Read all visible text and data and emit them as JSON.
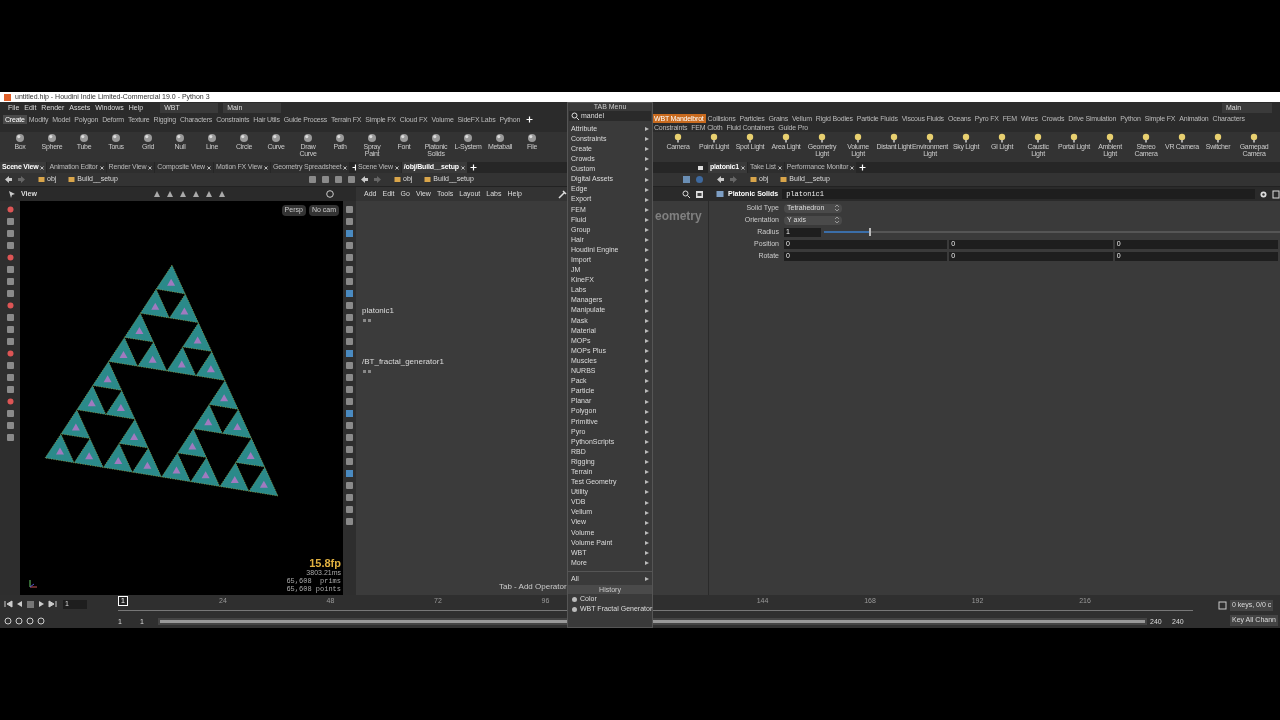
{
  "title_bar": {
    "title": "untitled.hip - Houdini Indie Limited-Commercial 19.0 - Python 3"
  },
  "menu_bar": {
    "items": [
      "File",
      "Edit",
      "Render",
      "Assets",
      "Windows",
      "Help"
    ],
    "desktop": "WBT",
    "workspace": "Main",
    "right_workspace": "Main"
  },
  "shelf_left": {
    "tabs": [
      {
        "label": "Create",
        "selected": true
      },
      {
        "label": "Modify",
        "selected": false
      },
      {
        "label": "Model",
        "selected": false
      },
      {
        "label": "Polygon",
        "selected": false
      },
      {
        "label": "Deform",
        "selected": false
      },
      {
        "label": "Texture",
        "selected": false
      },
      {
        "label": "Rigging",
        "selected": false
      },
      {
        "label": "Characters",
        "selected": false
      },
      {
        "label": "Constraints",
        "selected": false
      },
      {
        "label": "Hair Utils",
        "selected": false
      },
      {
        "label": "Guide Process",
        "selected": false
      },
      {
        "label": "Terrain FX",
        "selected": false
      },
      {
        "label": "Simple FX",
        "selected": false
      },
      {
        "label": "Cloud FX",
        "selected": false
      },
      {
        "label": "Volume",
        "selected": false
      },
      {
        "label": "SideFX Labs",
        "selected": false
      },
      {
        "label": "Python",
        "selected": false
      }
    ],
    "tools": [
      "Box",
      "Sphere",
      "Tube",
      "Torus",
      "Grid",
      "Null",
      "Line",
      "Circle",
      "Curve",
      "Draw Curve",
      "Path",
      "Spray Paint",
      "Font",
      "Platonic Solids",
      "L-System",
      "Metaball",
      "File"
    ]
  },
  "shelf_right": {
    "tabs": [
      {
        "label": "WBT Mandelbrot",
        "selected": true
      },
      {
        "label": "Collisions",
        "selected": false
      },
      {
        "label": "Particles",
        "selected": false
      },
      {
        "label": "Grains",
        "selected": false
      },
      {
        "label": "Vellum",
        "selected": false
      },
      {
        "label": "Rigid Bodies",
        "selected": false
      },
      {
        "label": "Particle Fluids",
        "selected": false
      },
      {
        "label": "Viscous Fluids",
        "selected": false
      },
      {
        "label": "Oceans",
        "selected": false
      },
      {
        "label": "Pyro FX",
        "selected": false
      },
      {
        "label": "FEM",
        "selected": false
      },
      {
        "label": "Wires",
        "selected": false
      },
      {
        "label": "Crowds",
        "selected": false
      },
      {
        "label": "Drive Simulation",
        "selected": false
      },
      {
        "label": "Python",
        "selected": false
      },
      {
        "label": "Simple FX",
        "selected": false
      },
      {
        "label": "Animation",
        "selected": false
      },
      {
        "label": "Characters",
        "selected": false
      },
      {
        "label": "Constraints",
        "selected": false
      },
      {
        "label": "FEM Cloth",
        "selected": false
      },
      {
        "label": "Fluid Containers",
        "selected": false
      },
      {
        "label": "Guide Pro",
        "selected": false
      }
    ],
    "tools": [
      "Camera",
      "Point Light",
      "Spot Light",
      "Area Light",
      "Geometry Light",
      "Volume Light",
      "Distant Light",
      "Environment Light",
      "Sky Light",
      "GI Light",
      "Caustic Light",
      "Portal Light",
      "Ambient Light",
      "Stereo Camera",
      "VR Camera",
      "Switcher",
      "Gamepad Camera"
    ]
  },
  "pane_tabs_left": [
    {
      "label": "Scene View",
      "selected": true
    },
    {
      "label": "Animation Editor",
      "selected": false
    },
    {
      "label": "Render View",
      "selected": false
    },
    {
      "label": "Composite View",
      "selected": false
    },
    {
      "label": "Motion FX View",
      "selected": false
    },
    {
      "label": "Geometry Spreadsheet",
      "selected": false
    }
  ],
  "pane_tabs_mid": [
    {
      "label": "Scene View",
      "selected": false
    },
    {
      "label": "/obj/Build__setup",
      "selected": true
    }
  ],
  "pane_tabs_right": [
    {
      "label": "platonic1",
      "selected": true
    },
    {
      "label": "Take List",
      "selected": false
    },
    {
      "label": "Performance Monitor",
      "selected": false
    }
  ],
  "path_left": [
    "obj",
    "Build__setup"
  ],
  "path_mid": [
    "obj",
    "Build__setup"
  ],
  "path_right": [
    "obj",
    "Build__setup"
  ],
  "viewport": {
    "title": "View",
    "camera": "Persp",
    "cam_menu": "No cam",
    "fps": "15.8fp",
    "time": "3803.21ms",
    "prims": "65,608  prims",
    "points": "65,608 points"
  },
  "network": {
    "menu": [
      "Add",
      "Edit",
      "Go",
      "View",
      "Tools",
      "Layout",
      "Labs",
      "Help"
    ],
    "nodes": [
      {
        "label": "platonic1"
      },
      {
        "label": "/BT_fractal_generator1"
      }
    ],
    "context_label": "eometry",
    "hint": "Tab - Add Operator"
  },
  "parameters": {
    "node_type": "Platonic Solids",
    "node_name": "platonic1",
    "rows": [
      {
        "kind": "menu",
        "label": "Solid Type",
        "value": "Tetrahedron"
      },
      {
        "kind": "menu",
        "label": "Orientation",
        "value": "Y axis"
      },
      {
        "kind": "slider",
        "label": "Radius",
        "value": "1",
        "level": 0.1
      },
      {
        "kind": "vector",
        "label": "Position",
        "values": [
          "0",
          "0",
          "0"
        ]
      },
      {
        "kind": "vector",
        "label": "Rotate",
        "values": [
          "0",
          "0",
          "0"
        ]
      }
    ]
  },
  "tab_menu": {
    "title": "TAB Menu",
    "search": "mandel",
    "items": [
      "Attribute",
      "Constraints",
      "Create",
      "Crowds",
      "Custom",
      "Digital Assets",
      "Edge",
      "Export",
      "FEM",
      "Fluid",
      "Group",
      "Hair",
      "Houdini Engine",
      "Import",
      "JM",
      "KineFX",
      "Labs",
      "Managers",
      "Manipulate",
      "Mask",
      "Material",
      "MOPs",
      "MOPs Plus",
      "Muscles",
      "NURBS",
      "Pack",
      "Particle",
      "Planar",
      "Polygon",
      "Primitive",
      "Pyro",
      "PythonScripts",
      "RBD",
      "Rigging",
      "Terrain",
      "Test Geometry",
      "Utility",
      "VDB",
      "Vellum",
      "View",
      "Volume",
      "Volume Paint",
      "WBT",
      "More"
    ],
    "all": "All",
    "history_title": "History",
    "history": [
      "Color",
      "WBT Fractal Generator"
    ]
  },
  "timeline": {
    "range_slider": {
      "level": 1
    },
    "frame": "1",
    "marker": "1",
    "ticks": [
      "24",
      "48",
      "72",
      "96",
      "144",
      "168",
      "192",
      "216"
    ],
    "start": "1",
    "range_start": "1",
    "range_end": "240",
    "end": "240",
    "keys": "0 keys, 0/0 c",
    "key_all": "Key All Chann"
  }
}
